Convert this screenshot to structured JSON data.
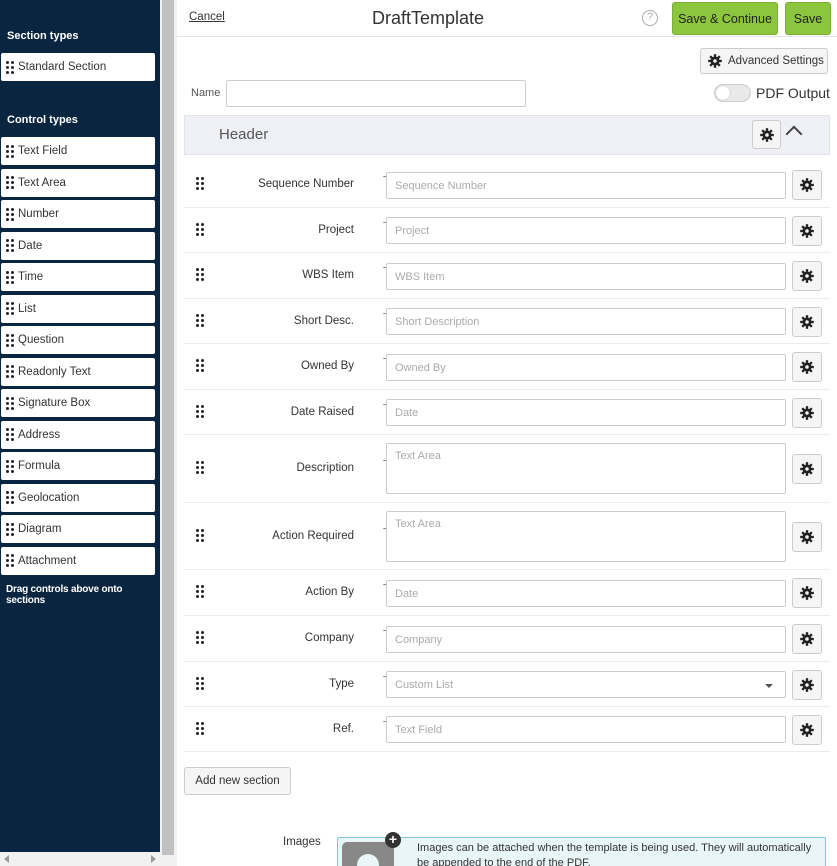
{
  "sidebar": {
    "section_types_heading": "Section types",
    "section_types": [
      {
        "label": "Standard Section"
      }
    ],
    "control_types_heading": "Control types",
    "control_types": [
      {
        "label": "Text Field"
      },
      {
        "label": "Text Area"
      },
      {
        "label": "Number"
      },
      {
        "label": "Date"
      },
      {
        "label": "Time"
      },
      {
        "label": "List"
      },
      {
        "label": "Question"
      },
      {
        "label": "Readonly Text"
      },
      {
        "label": "Signature Box"
      },
      {
        "label": "Address"
      },
      {
        "label": "Formula"
      },
      {
        "label": "Geolocation"
      },
      {
        "label": "Diagram"
      },
      {
        "label": "Attachment"
      }
    ],
    "hint": "Drag controls above onto sections"
  },
  "topbar": {
    "cancel_label": "Cancel",
    "title": "DraftTemplate",
    "help_icon": "question-icon",
    "save_continue_label": "Save & Continue",
    "save_label": "Save"
  },
  "settings": {
    "advanced_label": "Advanced Settings",
    "name_label": "Name",
    "name_value": "",
    "pdf_output_label": "PDF Output",
    "pdf_output_on": false
  },
  "section": {
    "title": "Header",
    "fields": [
      {
        "label": "Sequence Number",
        "placeholder": "Sequence Number",
        "kind": "input"
      },
      {
        "label": "Project",
        "placeholder": "Project",
        "kind": "input"
      },
      {
        "label": "WBS Item",
        "placeholder": "WBS Item",
        "kind": "input"
      },
      {
        "label": "Short Desc.",
        "placeholder": "Short Description",
        "kind": "input"
      },
      {
        "label": "Owned By",
        "placeholder": "Owned By",
        "kind": "input"
      },
      {
        "label": "Date Raised",
        "placeholder": "Date",
        "kind": "input"
      },
      {
        "label": "Description",
        "placeholder": "Text Area",
        "kind": "area"
      },
      {
        "label": "Action Required",
        "placeholder": "Text Area",
        "kind": "area"
      },
      {
        "label": "Action By",
        "placeholder": "Date",
        "kind": "input"
      },
      {
        "label": "Company",
        "placeholder": "Company",
        "kind": "input"
      },
      {
        "label": "Type",
        "placeholder": "Custom List",
        "kind": "select"
      },
      {
        "label": "Ref.",
        "placeholder": "Text Field",
        "kind": "input"
      }
    ]
  },
  "add_section_label": "Add new section",
  "images": {
    "label": "Images",
    "info": "Images can be attached when the template is being used. They will automatically be appended to the end of the PDF."
  },
  "colors": {
    "sidebar_bg": "#0a2540",
    "accent_green": "#8cc63f",
    "info_box_bg": "#e8f6f8"
  }
}
